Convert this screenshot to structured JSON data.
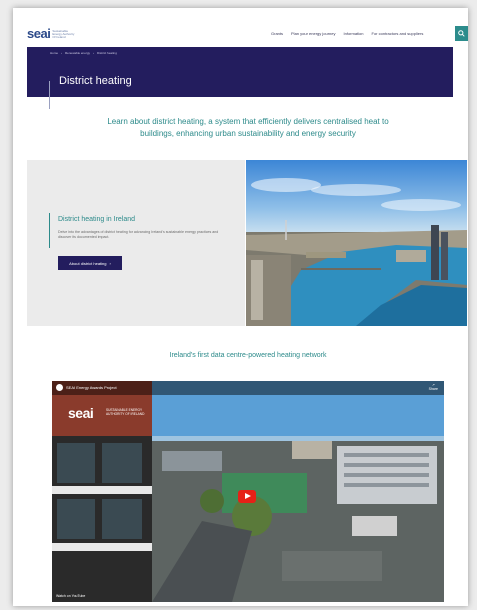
{
  "header": {
    "logo": "seai",
    "logo_tagline": "Sustainable Energy Authority Of Ireland",
    "nav": [
      "Grants",
      "Plan your energy journey",
      "Information",
      "For contractors and suppliers"
    ]
  },
  "hero": {
    "breadcrumb": [
      "Home",
      "Renewable energy",
      "District heating"
    ],
    "title": "District heating"
  },
  "intro": "Learn about district heating, a system that efficiently delivers centralised heat to buildings, enhancing urban sustainability and energy security",
  "feature": {
    "title": "District heating in Ireland",
    "description": "Delve into the advantages of district heating for advancing Ireland's sustainable energy practices and discover its documented impact.",
    "button_label": "About district heating",
    "button_arrow": "›"
  },
  "video_section": {
    "heading": "Ireland's first data centre-powered heating network",
    "video_title": "SEAI Energy Awards Project",
    "logo": "seai",
    "logo_sub": "SUSTAINABLE ENERGY AUTHORITY OF IRELAND",
    "share_label": "Share",
    "watch_label": "Watch on YouTube"
  },
  "colors": {
    "navy": "#231d5e",
    "teal": "#2c8a8a",
    "youtube_red": "#e62117"
  }
}
